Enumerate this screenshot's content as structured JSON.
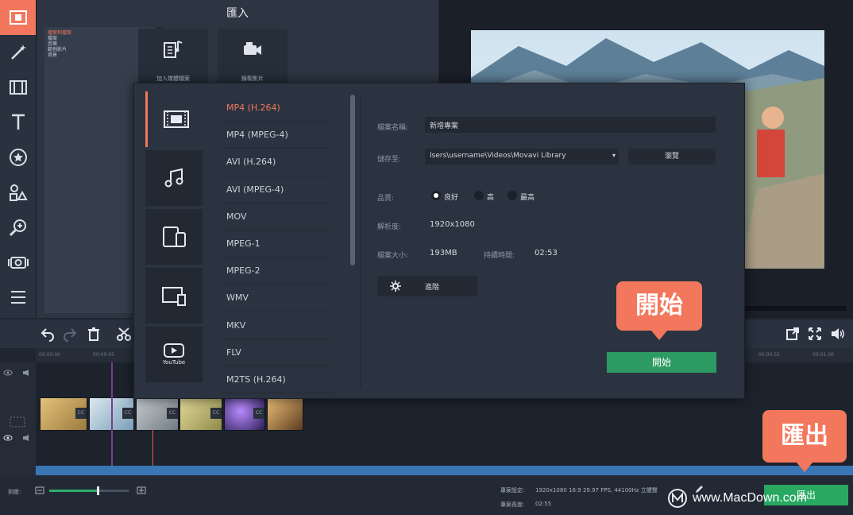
{
  "window": {
    "title": "匯入"
  },
  "sidebar": {
    "tools": [
      {
        "icon": "film-import-icon",
        "active": true
      },
      {
        "icon": "magic-wand-icon"
      },
      {
        "icon": "filmstrip-icon"
      },
      {
        "icon": "text-icon"
      },
      {
        "icon": "star-filter-icon"
      },
      {
        "icon": "shapes-icon"
      },
      {
        "icon": "zoom-icon"
      },
      {
        "icon": "camera-icon"
      },
      {
        "icon": "list-icon"
      }
    ]
  },
  "import_panel": {
    "title": "匯入",
    "categories": [
      "檔案和檔案",
      "檔案",
      "音樂",
      "範例影片",
      "背景"
    ],
    "tiles": [
      {
        "label": "加入媒體檔案",
        "icon": "add-media-icon"
      },
      {
        "label": "錄製影片",
        "icon": "record-video-icon"
      }
    ]
  },
  "export_dialog": {
    "tabs": [
      {
        "icon": "video-icon",
        "active": true
      },
      {
        "icon": "music-icon"
      },
      {
        "icon": "devices-icon"
      },
      {
        "icon": "tv-icon"
      },
      {
        "icon": "youtube-icon",
        "label": "YouTube"
      }
    ],
    "formats": [
      "MP4 (H.264)",
      "MP4 (MPEG-4)",
      "AVI (H.264)",
      "AVI (MPEG-4)",
      "MOV",
      "MPEG-1",
      "MPEG-2",
      "WMV",
      "MKV",
      "FLV",
      "M2TS (H.264)"
    ],
    "selected_format": "MP4 (H.264)",
    "filename_label": "檔案名稱:",
    "filename_value": "新增專案",
    "save_to_label": "儲存至:",
    "save_to_value": "Isers\\username\\Videos\\Movavi Library",
    "browse_label": "瀏覽",
    "quality_label": "品質:",
    "quality_options": [
      "良好",
      "高",
      "最高"
    ],
    "quality_selected": 0,
    "resolution_label": "解析度:",
    "resolution_value": "1920x1080",
    "filesize_label": "檔案大小:",
    "filesize_value": "193MB",
    "duration_label": "持續時間:",
    "duration_value": "02:53",
    "settings_label": "進階",
    "start_label": "開始"
  },
  "callouts": {
    "start": "開始",
    "export": "匯出"
  },
  "timeline": {
    "ruler_ticks": [
      "00:00:00",
      "00:00:05"
    ],
    "ruler_ticks_right": [
      "00:00:55",
      "00:01:00"
    ],
    "clip_badge": "CC",
    "zoom_label": "刻度:",
    "project_settings_label": "專案設定:",
    "project_settings_value": "1920x1080 16:9 29.97 FPS, 44100Hz 立體聲",
    "project_length_label": "專案長度:",
    "project_length_value": "02:55",
    "export_button_label": "匯出"
  },
  "watermark": "www.MacDown.com",
  "colors": {
    "accent": "#f2775c",
    "start_green": "#2e9a63",
    "export_green": "#29a862",
    "bg": "#1f2631"
  }
}
